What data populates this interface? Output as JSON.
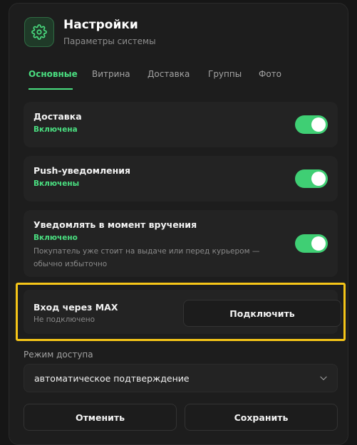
{
  "header": {
    "icon": "gear-icon",
    "title": "Настройки",
    "subtitle": "Параметры системы"
  },
  "tabs": [
    {
      "label": "Основные",
      "active": true
    },
    {
      "label": "Витрина",
      "active": false
    },
    {
      "label": "Доставка",
      "active": false
    },
    {
      "label": "Группы",
      "active": false
    },
    {
      "label": "Фото",
      "active": false
    }
  ],
  "settings": [
    {
      "title": "Доставка",
      "status": "Включена",
      "enabled": true
    },
    {
      "title": "Push-уведомления",
      "status": "Включены",
      "enabled": true
    },
    {
      "title": "Уведомлять в момент вручения",
      "status": "Включено",
      "description": "Покупатель уже стоит на выдаче или перед курьером — обычно избыточно",
      "enabled": true
    }
  ],
  "max_login": {
    "title": "Вход через MAX",
    "status": "Не подключено",
    "connect_label": "Подключить"
  },
  "access": {
    "label": "Режим доступа",
    "value": "автоматическое подтверждение",
    "icon": "chevron-down-icon"
  },
  "actions": {
    "cancel_label": "Отменить",
    "save_label": "Сохранить"
  },
  "colors": {
    "accent": "#4ade80",
    "toggle_on": "#3fcf74",
    "highlight": "#f5c518"
  }
}
